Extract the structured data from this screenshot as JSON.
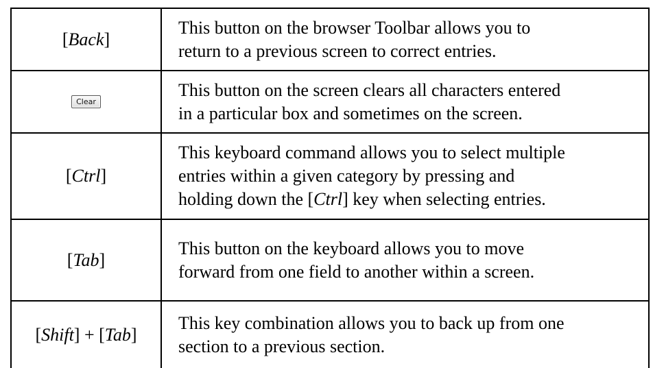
{
  "rows": [
    {
      "key": "[Back]",
      "description_lines": [
        "This button on the browser Toolbar allows you to",
        "return to a previous screen to correct entries."
      ]
    },
    {
      "key_button_label": "Clear",
      "description_lines": [
        "This button on the screen clears all characters entered",
        "in a particular box and sometimes on the screen."
      ]
    },
    {
      "key": "[Ctrl]",
      "description_lines": [
        "This keyboard command allows you to select multiple",
        "entries within a given category by pressing and",
        "holding down the [Ctrl] key when selecting entries."
      ]
    },
    {
      "key": "[Tab]",
      "description_lines": [
        "This button on the keyboard allows you to move",
        "forward from one field to another within a screen."
      ]
    },
    {
      "key": "[Shift] + [Tab]",
      "description_lines": [
        "This key combination allows you to back up from one",
        "section to a previous section."
      ]
    }
  ]
}
